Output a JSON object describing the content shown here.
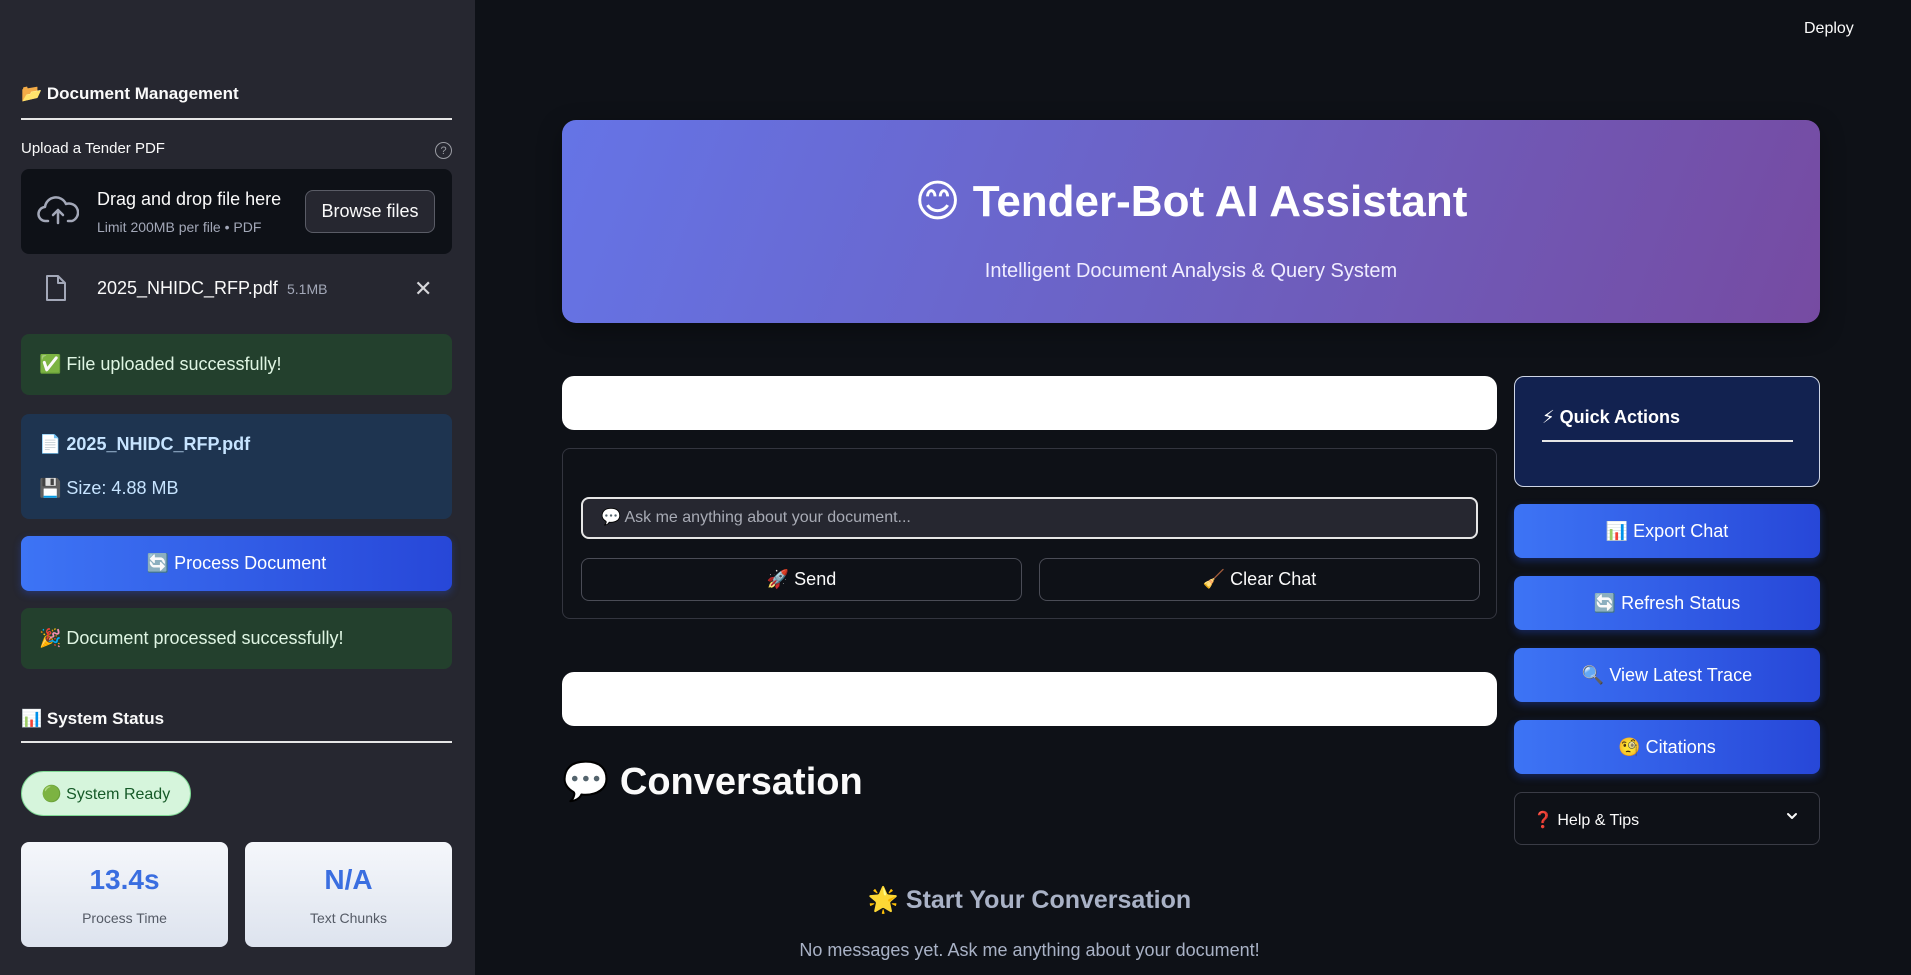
{
  "sidebar": {
    "doc_mgmt_title": "📂 Document Management",
    "upload_label": "Upload a Tender PDF",
    "help_glyph": "?",
    "dropzone": {
      "title": "Drag and drop file here",
      "subtitle": "Limit 200MB per file • PDF",
      "browse_label": "Browse files"
    },
    "uploaded_file": {
      "name": "2025_NHIDC_RFP.pdf",
      "size": "5.1MB",
      "close_glyph": "✕"
    },
    "upload_success": "✅ File uploaded successfully!",
    "file_info": {
      "name_line": "📄 2025_NHIDC_RFP.pdf",
      "size_line": "💾 Size: 4.88 MB"
    },
    "process_button": "🔄 Process Document",
    "process_success": "🎉 Document processed successfully!",
    "system_status_title": "📊 System Status",
    "status_pill": "🟢 System Ready",
    "metrics": [
      {
        "value": "13.4s",
        "label": "Process Time"
      },
      {
        "value": "N/A",
        "label": "Text Chunks"
      }
    ]
  },
  "header": {
    "deploy_label": "Deploy"
  },
  "hero": {
    "title": "😊 Tender-Bot AI Assistant",
    "subtitle": "Intelligent Document Analysis & Query System"
  },
  "chat": {
    "input_placeholder": "💬 Ask me anything about your document...",
    "send_label": "🚀 Send",
    "clear_label": "🧹 Clear Chat"
  },
  "conversation": {
    "title": "💬 Conversation",
    "empty_title": "🌟 Start Your Conversation",
    "empty_subtitle": "No messages yet. Ask me anything about your document!"
  },
  "quick_actions": {
    "title": "⚡ Quick Actions",
    "buttons": [
      "📊 Export Chat",
      "🔄 Refresh Status",
      "🔍 View Latest Trace",
      "🧐 Citations"
    ],
    "help_label": "❓ Help & Tips"
  },
  "colors": {
    "background": "#0e1117",
    "sidebar": "#262730",
    "accent_blue": "#3d74f5",
    "hero_start": "#6574e6",
    "hero_end": "#764ba2",
    "success_bg": "#23402d",
    "info_bg": "#1e3450"
  },
  "icons": [
    "cloud-upload-icon",
    "file-icon",
    "close-icon",
    "help-icon",
    "chevron-down-icon"
  ]
}
